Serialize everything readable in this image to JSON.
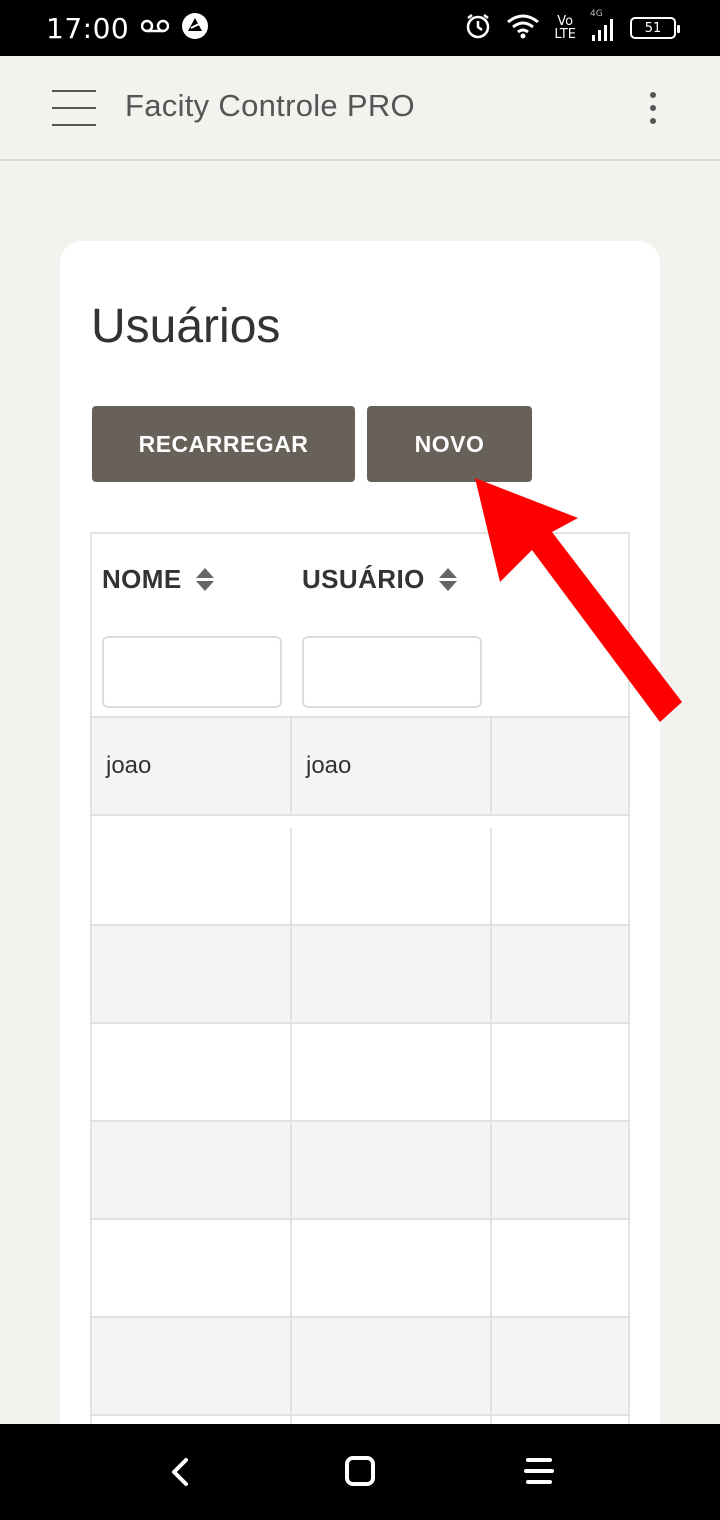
{
  "status_bar": {
    "time": "17:00",
    "network_top": "Vo",
    "network_bottom": "LTE",
    "network_gen": "4G",
    "battery": "51"
  },
  "app_bar": {
    "title": "Facity Controle PRO",
    "menu_icon": "hamburger-icon",
    "overflow_icon": "more-vert-icon"
  },
  "page": {
    "title": "Usuários",
    "buttons": {
      "reload": "RECARREGAR",
      "new": "NOVO"
    },
    "table": {
      "columns": [
        "NOME",
        "USUÁRIO"
      ],
      "rows": [
        [
          "joao",
          "joao",
          ""
        ],
        [
          "",
          "",
          ""
        ],
        [
          "",
          "",
          ""
        ],
        [
          "",
          "",
          ""
        ],
        [
          "",
          "",
          ""
        ],
        [
          "",
          "",
          ""
        ],
        [
          "",
          "",
          ""
        ],
        [
          "",
          "",
          ""
        ]
      ]
    }
  },
  "annotation": {
    "arrow_color": "#ff0000",
    "points_to": "NOVO"
  },
  "colors": {
    "button_bg": "#676159",
    "page_bg": "#f3f2ef"
  }
}
